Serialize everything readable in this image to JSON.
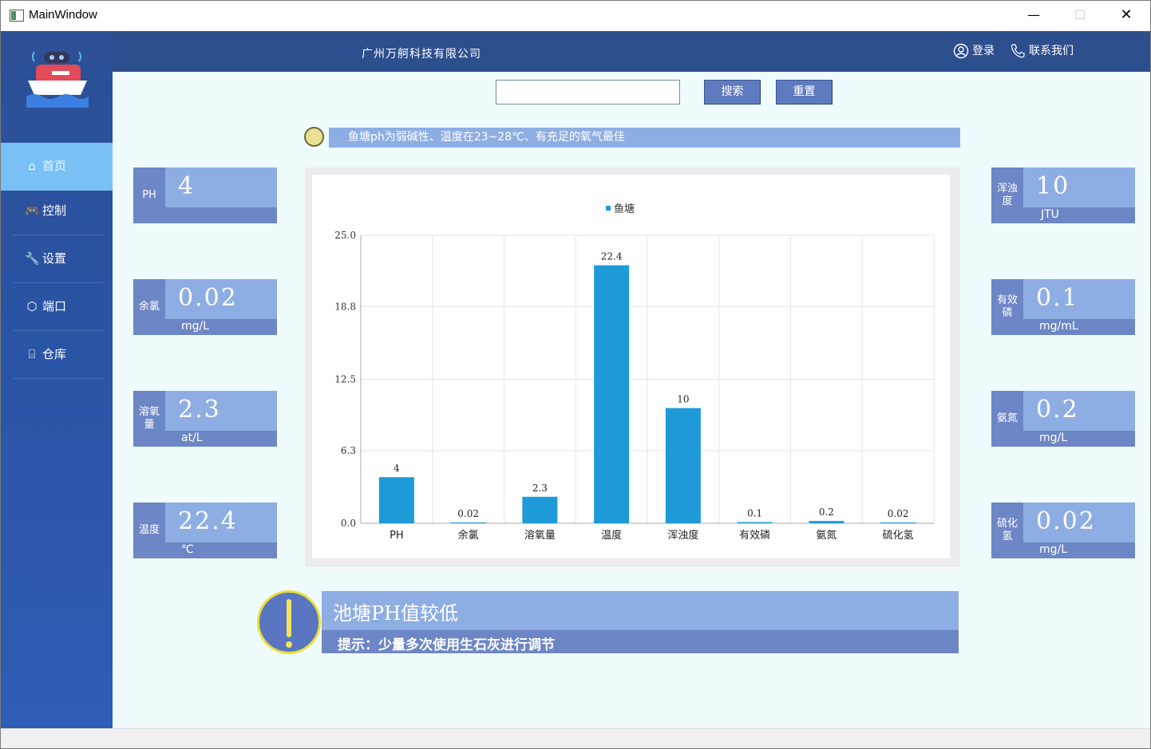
{
  "window": {
    "title": "MainWindow",
    "minimize": "—",
    "maximize": "☐",
    "close": "✕"
  },
  "header": {
    "company": "广州万舸科技有限公司",
    "login": "登录",
    "contact": "联系我们"
  },
  "sidebar": {
    "items": [
      {
        "label": "首页",
        "icon": "⌂"
      },
      {
        "label": "控制",
        "icon": "🎮"
      },
      {
        "label": "设置",
        "icon": "🔧"
      },
      {
        "label": "端口",
        "icon": "⬡"
      },
      {
        "label": "仓库",
        "icon": "⌸"
      }
    ]
  },
  "search": {
    "value": "",
    "placeholder": "",
    "search_label": "搜索",
    "reset_label": "重置"
  },
  "tip": "鱼塘ph为弱碱性、温度在23~28℃、有充足的氧气最佳",
  "cards_left": [
    {
      "caption": "PH",
      "value": "4",
      "unit": ""
    },
    {
      "caption": "余氯",
      "value": "0.02",
      "unit": "mg/L"
    },
    {
      "caption": "溶氧量",
      "value": "2.3",
      "unit": "at/L"
    },
    {
      "caption": "温度",
      "value": "22.4",
      "unit": "℃"
    }
  ],
  "cards_right": [
    {
      "caption": "浑浊度",
      "value": "10",
      "unit": "JTU"
    },
    {
      "caption": "有效磷",
      "value": "0.1",
      "unit": "mg/mL"
    },
    {
      "caption": "氨氮",
      "value": "0.2",
      "unit": "mg/L"
    },
    {
      "caption": "硫化氢",
      "value": "0.02",
      "unit": "mg/L"
    }
  ],
  "chart_data": {
    "type": "bar",
    "categories": [
      "PH",
      "余氯",
      "溶氧量",
      "温度",
      "浑浊度",
      "有效磷",
      "氨氮",
      "硫化氢"
    ],
    "series": [
      {
        "name": "鱼塘",
        "values": [
          4,
          0.02,
          2.3,
          22.4,
          10,
          0.1,
          0.2,
          0.02
        ],
        "labels": [
          "4",
          "0.02",
          "2.3",
          "22.4",
          "10",
          "0.1",
          "0.2",
          "0.02"
        ]
      }
    ],
    "yticks": [
      "0.0",
      "6.3",
      "12.5",
      "18.8",
      "25.0"
    ],
    "ylim": [
      0,
      25
    ],
    "grid": true,
    "legend": "top-center",
    "bar_color": "#1f9ad9"
  },
  "alert": {
    "title": "池塘PH值较低",
    "hint": "提示：少量多次使用生石灰进行调节"
  }
}
